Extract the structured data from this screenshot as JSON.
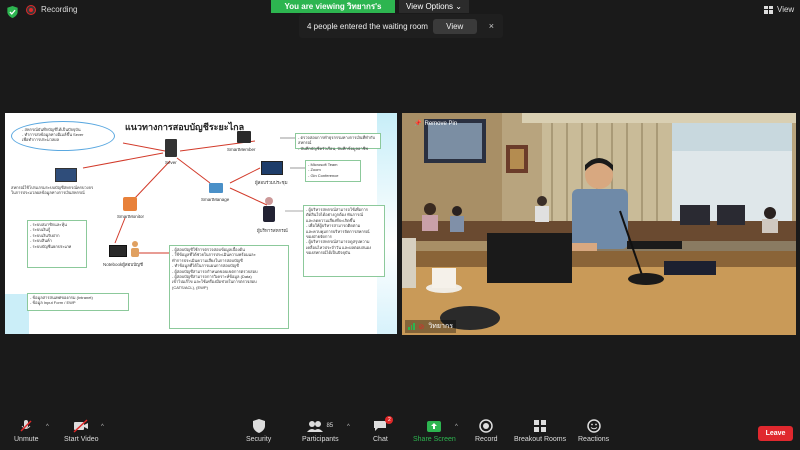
{
  "top": {
    "recording_label": "Recording",
    "viewing_banner": "You are viewing วิทยากร's screen",
    "view_options_label": "View Options",
    "view_label": "View"
  },
  "toast": {
    "message": "4 people entered the waiting room",
    "view_button": "View",
    "close": "×"
  },
  "slide": {
    "title": "แนวทางการสอบบัญชีระยะไกล",
    "ellipse_text": "- สหกรณ์บันทึกบัญชีได้เป็นปัจจุบัน\n- ทำการส่งข้อมูลทางอีเมล์ขึ้น Sever\n  เพื่อทำการประมวลผล",
    "sever_label": "Sever",
    "smartmember_label": "SmartMember",
    "smartmanage_label": "SmartManage",
    "smartmonitor_label": "SmartMonitor",
    "notebook_label": "Notebookผู้สอบบัญชี",
    "meeting_label": "ผู้สอบร่วมประชุม",
    "manager_label": "ผู้บริหารสหกรณ์",
    "left_desc": "สหกรณ์ใช้โปรแกรมระบบบัญชีสหกรณ์ครบวงจร\nในการประมวลผลข้อมูลทางการเงินสหกรณ์",
    "box_member": "- ตรวจสอบการทำธุรกรรมทางการเงินที่ทำกับสหกรณ์\n- บันทึกบัญชีครัวเรือน, บันทึกข้อมูลอาชีพ",
    "box_meeting": "- Microsoft Team\n- Zoom\n- Gin Conference",
    "box_systems": "- ระบบสมาชิกและหุ้น\n- ระบบเงินกู้\n- ระบบเงินรับฝาก\n- ระบบสินค้า\n- ระบบบัญชีแยกประเภท",
    "box_data": "- ข้อมูลสารสนเทศของกรม (Intranet)\n- ข้อมูล Input Form / EWP",
    "box_auditor": "- ผู้สอบบัญชีใช้การตรวจสอบข้อมูลเบื้องต้น\n- ใช้ข้อมูลที่ได้ช่วยในการประเมินความพร้อมและ\n  ทำการประเมินความเสี่ยงในการสอบบัญชี\n- ทำข้อมูลที่ได้ในการแผนการสอบบัญชี\n- ผู้สอบบัญชีสามารถกำหนดขอบเขตการตรวจสอบ\n- ผู้สอบบัญชีสามารถการวิเคราะห์ข้อมูล (Data)\n  เข้าไปแก้ไข และใช้เครื่องมือช่วยในการตรวจสอบ\n  (CATS/ACL), (EWP)",
    "box_manager": "- ผู้บริหารสหกรณ์สามารถใช้เพื่อการ\n  ตัดสินใจได้อย่างถูกต้อง ทันการณ์\n  และลดความเสี่ยงที่จะเกิดขึ้น\n- เพื่อให้ผู้บริหารสามารถติดตาม\n  และควบคุมการบริหารจัดการสหกรณ์\n  ของฝ่ายจัดการ\n- ผู้บริหารสหกรณ์สามารถดูสรุปความ\n  เคลื่อนไหวประจำวัน และผลตอบสนอง\n  ของสหกรณ์ได้เป็นปัจจุบัน"
  },
  "camera": {
    "pinned_label": "Remove Pin",
    "name": "วิทยากร"
  },
  "toolbar": {
    "unmute": "Unmute",
    "start_video": "Start Video",
    "security": "Security",
    "participants": "Participants",
    "participants_count": "85",
    "chat": "Chat",
    "chat_badge": "2",
    "share_screen": "Share Screen",
    "record": "Record",
    "breakout_rooms": "Breakout Rooms",
    "reactions": "Reactions",
    "leave": "Leave"
  },
  "colors": {
    "banner_green": "#2db550",
    "leave_red": "#e0282e",
    "share_green": "#2db550"
  }
}
